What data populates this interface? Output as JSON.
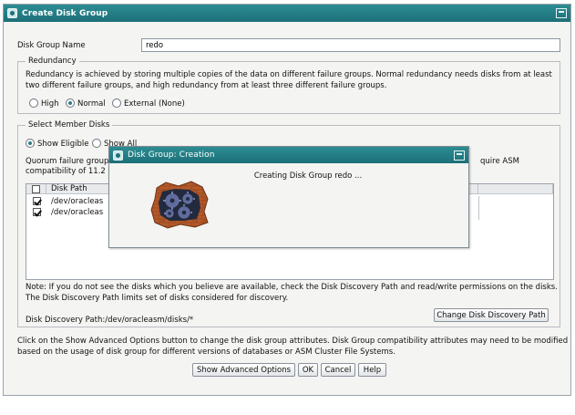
{
  "window": {
    "title": "Create Disk Group"
  },
  "disk_group_name": {
    "label": "Disk Group Name",
    "value": "redo"
  },
  "redundancy": {
    "legend": "Redundancy",
    "description_line1": "Redundancy is achieved by storing multiple copies of the data on different failure groups. Normal redundancy needs disks from at least",
    "description_line2": "two different failure groups, and high redundancy from at least three different failure groups.",
    "options": [
      {
        "label": "High",
        "selected": false
      },
      {
        "label": "Normal",
        "selected": true
      },
      {
        "label": "External (None)",
        "selected": false
      }
    ]
  },
  "member_disks": {
    "legend": "Select Member Disks",
    "filter_options": [
      {
        "label": "Show Eligible",
        "selected": true
      },
      {
        "label": "Show All",
        "selected": false
      }
    ],
    "quorum_text_left": "Quorum failure group",
    "quorum_text_right": "quire ASM",
    "compat_text": "compatibility of 11.2 c",
    "table": {
      "column_disk_path": "Disk Path",
      "rows": [
        {
          "checked": true,
          "path": "/dev/oracleas"
        },
        {
          "checked": true,
          "path": "/dev/oracleas"
        }
      ]
    },
    "note_line1": "Note: If you do not see the disks which you believe are available, check the Disk Discovery Path and read/write permissions on the disks.",
    "note_line2": "The Disk Discovery Path limits set of disks considered for discovery.",
    "discovery_path_label": "Disk Discovery Path:",
    "discovery_path_value": "/dev/oracleasm/disks/*",
    "change_path_button": "Change Disk Discovery Path"
  },
  "advanced_text_line1": "Click on the Show Advanced Options button to change the disk group attributes. Disk Group compatibility attributes may need to be modified",
  "advanced_text_line2": "based on the usage of disk group for different versions of databases or ASM Cluster File Systems.",
  "buttons": {
    "show_advanced": "Show Advanced Options",
    "ok": "OK",
    "cancel": "Cancel",
    "help": "Help"
  },
  "progress_dialog": {
    "title": "Disk Group: Creation",
    "message": "Creating Disk Group redo ..."
  },
  "colors": {
    "titlebar": "#1c6f78",
    "window_bg": "#f4f4f2"
  }
}
